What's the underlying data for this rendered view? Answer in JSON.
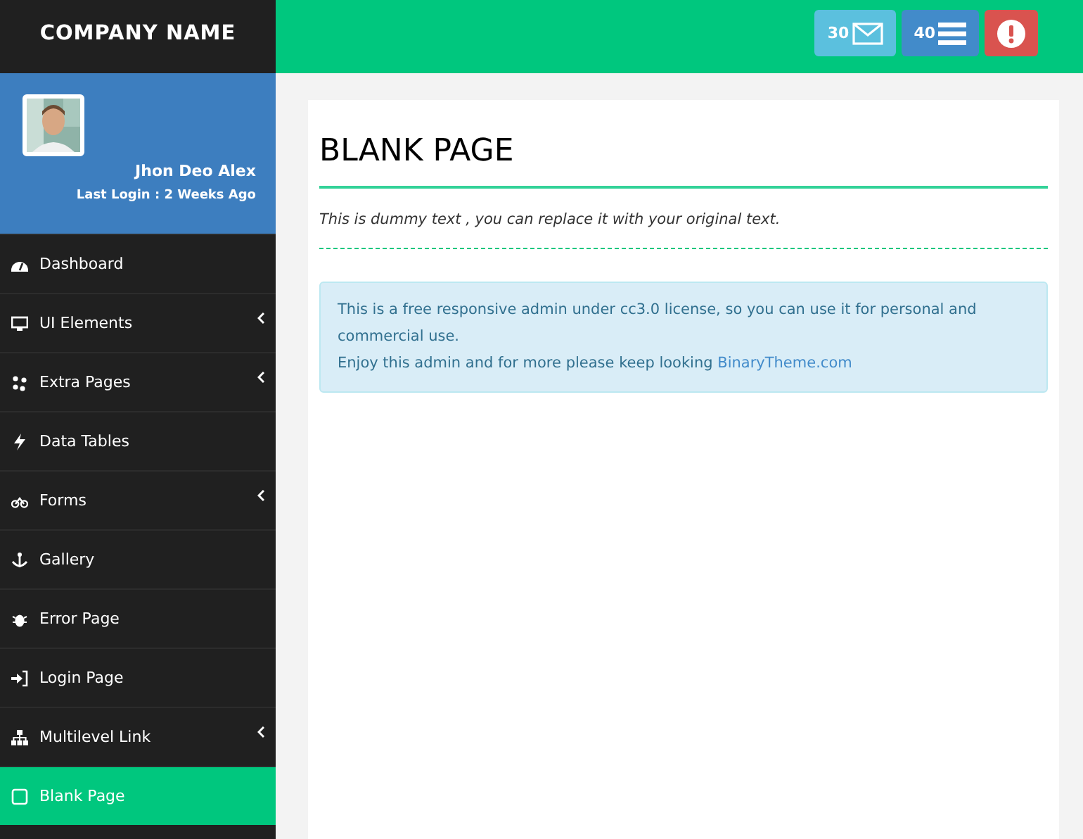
{
  "brand": "COMPANY NAME",
  "header_buttons": [
    {
      "kind": "mail",
      "count": "30",
      "color": "#5bc0de"
    },
    {
      "kind": "list",
      "count": "40",
      "color": "#428bca"
    },
    {
      "kind": "alert",
      "color": "#d9534f"
    }
  ],
  "profile": {
    "name": "Jhon Deo Alex",
    "last_login": "Last Login : 2 Weeks Ago"
  },
  "sidebar": {
    "items": [
      {
        "label": "Dashboard",
        "has_submenu": false,
        "selected": false
      },
      {
        "label": "UI Elements",
        "has_submenu": true,
        "selected": false
      },
      {
        "label": "Extra Pages",
        "has_submenu": true,
        "selected": false
      },
      {
        "label": "Data Tables",
        "has_submenu": false,
        "selected": false
      },
      {
        "label": "Forms",
        "has_submenu": true,
        "selected": false
      },
      {
        "label": "Gallery",
        "has_submenu": false,
        "selected": false
      },
      {
        "label": "Error Page",
        "has_submenu": false,
        "selected": false
      },
      {
        "label": "Login Page",
        "has_submenu": false,
        "selected": false
      },
      {
        "label": "Multilevel Link",
        "has_submenu": true,
        "selected": false
      },
      {
        "label": "Blank Page",
        "has_submenu": false,
        "selected": true
      }
    ]
  },
  "page": {
    "title": "BLANK PAGE",
    "subtitle": "This is dummy text , you can replace it with your original text.",
    "alert": {
      "line_1": "This is a free responsive admin under cc3.0 license, so you can use it for personal and commercial use.",
      "line_2": "Enjoy this admin and for more please keep looking ",
      "link": "BinaryTheme.com"
    }
  }
}
